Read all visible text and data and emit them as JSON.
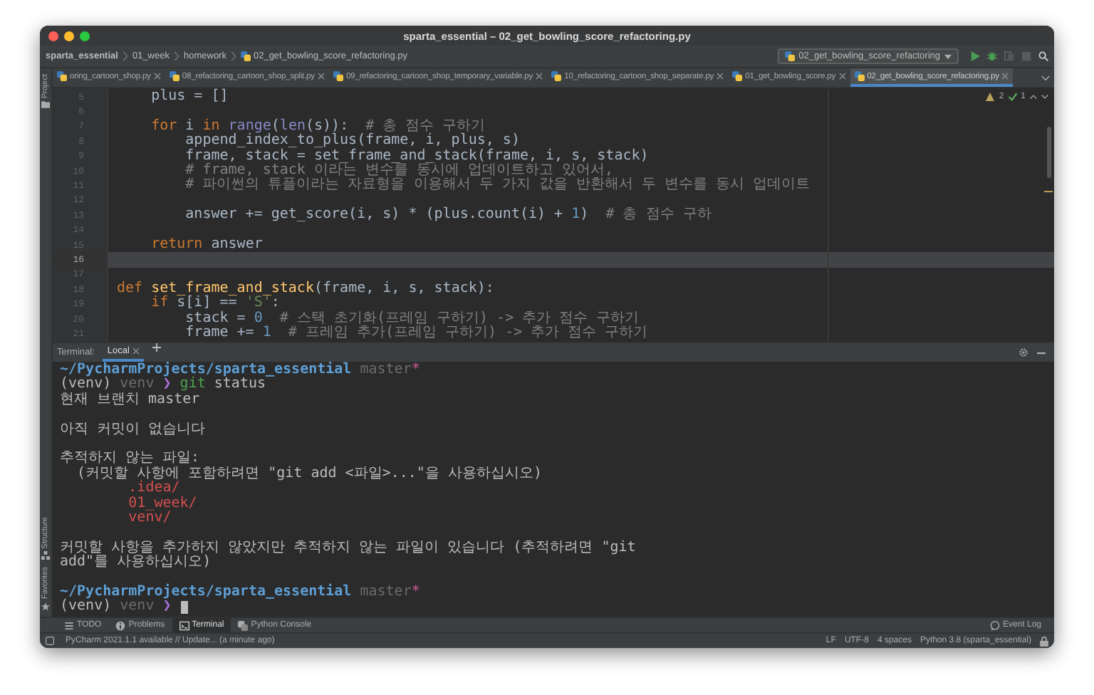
{
  "window": {
    "title": "sparta_essential – 02_get_bowling_score_refactoring.py"
  },
  "breadcrumbs": [
    "sparta_essential",
    "01_week",
    "homework",
    "02_get_bowling_score_refactoring.py"
  ],
  "run_config": {
    "label": "02_get_bowling_score_refactoring"
  },
  "tabs": [
    {
      "label": "oring_cartoon_shop.py",
      "selected": false
    },
    {
      "label": "08_refactoring_cartoon_shop_split.py",
      "selected": false
    },
    {
      "label": "09_refactoring_cartoon_shop_temporary_variable.py",
      "selected": false
    },
    {
      "label": "10_refactoring_cartoon_shop_separate.py",
      "selected": false
    },
    {
      "label": "01_get_bowling_score.py",
      "selected": false
    },
    {
      "label": "02_get_bowling_score_refactoring.py",
      "selected": true
    }
  ],
  "left_strip": {
    "top": [
      "Project"
    ],
    "bottom": [
      "Structure",
      "Favorites"
    ]
  },
  "editor": {
    "inspections": {
      "warnings": "2",
      "weak_warnings": "1"
    },
    "lines": [
      {
        "number": "5",
        "current": false,
        "tokens": [
          {
            "t": "    plus = []",
            "kind": "plain"
          }
        ]
      },
      {
        "number": "6",
        "current": false
      },
      {
        "number": "7",
        "current": false,
        "tokens": [
          {
            "t": "    for",
            "kind": "kw"
          },
          {
            "t": " i ",
            "kind": "plain"
          },
          {
            "t": "in",
            "kind": "kw"
          },
          {
            "t": " range",
            "kind": "builtin"
          },
          {
            "t": "(",
            "kind": "plain"
          },
          {
            "t": "len",
            "kind": "builtin"
          },
          {
            "t": "(s)):",
            "kind": "plain"
          },
          {
            "t": "  # 총 점수 구하기",
            "kind": "comment"
          }
        ]
      },
      {
        "number": "8",
        "current": false,
        "tokens": [
          {
            "t": "        append_index_to_plus(frame, i, plus, s)",
            "kind": "plain"
          }
        ]
      },
      {
        "number": "9",
        "current": false,
        "tokens": [
          {
            "t": "        frame, stack = set_frame_and_stack(frame, i, s, stack)",
            "kind": "plain"
          }
        ]
      },
      {
        "number": "10",
        "current": false,
        "tokens": [
          {
            "t": "        # frame, stack 이라는 변수를 동시에 업데이트하고 있어서,",
            "kind": "comment"
          }
        ]
      },
      {
        "number": "11",
        "current": false,
        "tokens": [
          {
            "t": "        # 파이썬의 튜플이라는 자료형을 이용해서 두 가지 값을 반환해서 두 변수를 동시 업데이트",
            "kind": "comment"
          }
        ]
      },
      {
        "number": "12",
        "current": false
      },
      {
        "number": "13",
        "current": false,
        "tokens": [
          {
            "t": "        answer += get_score(i, s) * (plus.count(i) + ",
            "kind": "plain"
          },
          {
            "t": "1",
            "kind": "number"
          },
          {
            "t": ")",
            "kind": "plain"
          },
          {
            "t": "  # 총 점수 구하",
            "kind": "comment"
          }
        ]
      },
      {
        "number": "14",
        "current": false
      },
      {
        "number": "15",
        "current": false,
        "tokens": [
          {
            "t": "    return",
            "kind": "kw"
          },
          {
            "t": " answer",
            "kind": "plain"
          }
        ]
      },
      {
        "number": "16",
        "current": true
      },
      {
        "number": "17",
        "current": false
      },
      {
        "number": "18",
        "current": false,
        "tokens": [
          {
            "t": "def",
            "kind": "kw"
          },
          {
            "t": " set_frame_and_stack",
            "kind": "fn"
          },
          {
            "t": "(frame, i, s, stack):",
            "kind": "plain"
          }
        ]
      },
      {
        "number": "19",
        "current": false,
        "tokens": [
          {
            "t": "    if",
            "kind": "kw"
          },
          {
            "t": " s[i] == ",
            "kind": "plain"
          },
          {
            "t": "'S'",
            "kind": "string"
          },
          {
            "t": ":",
            "kind": "plain"
          }
        ]
      },
      {
        "number": "20",
        "current": false,
        "tokens": [
          {
            "t": "        stack = ",
            "kind": "plain"
          },
          {
            "t": "0",
            "kind": "number"
          },
          {
            "t": "  # 스택 초기화(프레임 구하기) -> 추가 점수 구하기",
            "kind": "comment"
          }
        ]
      },
      {
        "number": "21",
        "current": false,
        "tokens": [
          {
            "t": "        frame += ",
            "kind": "plain"
          },
          {
            "t": "1",
            "kind": "number"
          },
          {
            "t": "  # 프레임 추가(프레임 구하기) -> 추가 점수 구하기",
            "kind": "comment"
          }
        ]
      }
    ]
  },
  "terminal": {
    "label": "Terminal:",
    "tabs": [
      {
        "label": "Local",
        "selected": true
      }
    ],
    "cursor": true,
    "blocks": [
      [
        {
          "tokens": [
            {
              "t": "~/PycharmProjects/sparta_essential",
              "kind": "path"
            },
            {
              "t": " master",
              "kind": "dim"
            },
            {
              "t": "*",
              "kind": "star"
            }
          ]
        },
        {
          "tokens": [
            {
              "t": "(venv)",
              "kind": "text"
            },
            {
              "t": " venv",
              "kind": "dim"
            },
            {
              "t": " ❯",
              "kind": "arrow"
            },
            {
              "t": " git",
              "kind": "green"
            },
            {
              "t": " status",
              "kind": "text"
            }
          ]
        },
        {
          "tokens": [
            {
              "t": "현재 브랜치 master",
              "kind": "text"
            }
          ]
        }
      ],
      [
        {
          "tokens": [
            {
              "t": "아직 커밋이 없습니다",
              "kind": "text"
            }
          ]
        }
      ],
      [
        {
          "tokens": [
            {
              "t": "추적하지 않는 파일:",
              "kind": "text"
            }
          ]
        },
        {
          "tokens": [
            {
              "t": "  (커밋할 사항에 포함하려면 \"git add <파일>...\"을 사용하십시오)",
              "kind": "text"
            }
          ]
        },
        {
          "tokens": [
            {
              "t": "        .idea/",
              "kind": "red"
            }
          ]
        },
        {
          "tokens": [
            {
              "t": "        01_week/",
              "kind": "red"
            }
          ]
        },
        {
          "tokens": [
            {
              "t": "        venv/",
              "kind": "red"
            }
          ]
        }
      ],
      [
        {
          "tokens": [
            {
              "t": "커밋할 사항을 추가하지 않았지만 추적하지 않는 파일이 있습니다 (추적하려면 \"git",
              "kind": "text"
            }
          ]
        },
        {
          "tokens": [
            {
              "t": "add\"를 사용하십시오)",
              "kind": "text"
            }
          ]
        }
      ],
      [
        {
          "tokens": [
            {
              "t": "~/PycharmProjects/sparta_essential",
              "kind": "path"
            },
            {
              "t": " master",
              "kind": "dim"
            },
            {
              "t": "*",
              "kind": "star"
            }
          ]
        },
        {
          "tokens": [
            {
              "t": "(venv)",
              "kind": "text"
            },
            {
              "t": " venv",
              "kind": "dim"
            },
            {
              "t": " ❯",
              "kind": "arrow"
            }
          ]
        }
      ]
    ]
  },
  "tool_windows": [
    {
      "label": "TODO",
      "kind": "todo",
      "selected": false
    },
    {
      "label": "Problems",
      "kind": "problems",
      "selected": false
    },
    {
      "label": "Terminal",
      "kind": "terminal",
      "selected": true
    },
    {
      "label": "Python Console",
      "kind": "console",
      "selected": false
    }
  ],
  "event_log": "Event Log",
  "status_bar": {
    "message": "PyCharm 2021.1.1 available // Update... (a minute ago)",
    "items": [
      "LF",
      "UTF-8",
      "4 spaces",
      "Python 3.8 (sparta_essential)"
    ]
  }
}
